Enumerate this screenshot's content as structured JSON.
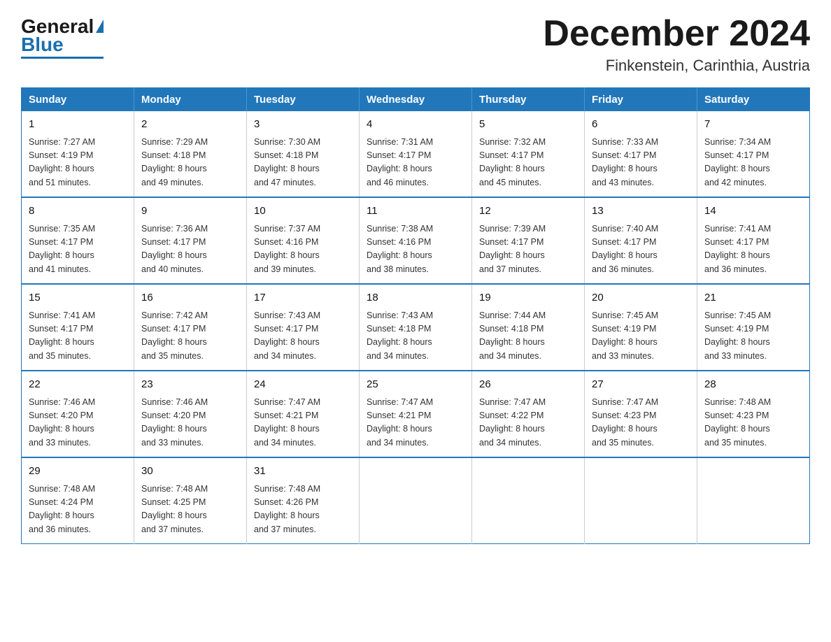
{
  "header": {
    "logo_general": "General",
    "logo_blue": "Blue",
    "title": "December 2024",
    "subtitle": "Finkenstein, Carinthia, Austria"
  },
  "calendar": {
    "headers": [
      "Sunday",
      "Monday",
      "Tuesday",
      "Wednesday",
      "Thursday",
      "Friday",
      "Saturday"
    ],
    "weeks": [
      [
        {
          "day": "1",
          "info": "Sunrise: 7:27 AM\nSunset: 4:19 PM\nDaylight: 8 hours\nand 51 minutes."
        },
        {
          "day": "2",
          "info": "Sunrise: 7:29 AM\nSunset: 4:18 PM\nDaylight: 8 hours\nand 49 minutes."
        },
        {
          "day": "3",
          "info": "Sunrise: 7:30 AM\nSunset: 4:18 PM\nDaylight: 8 hours\nand 47 minutes."
        },
        {
          "day": "4",
          "info": "Sunrise: 7:31 AM\nSunset: 4:17 PM\nDaylight: 8 hours\nand 46 minutes."
        },
        {
          "day": "5",
          "info": "Sunrise: 7:32 AM\nSunset: 4:17 PM\nDaylight: 8 hours\nand 45 minutes."
        },
        {
          "day": "6",
          "info": "Sunrise: 7:33 AM\nSunset: 4:17 PM\nDaylight: 8 hours\nand 43 minutes."
        },
        {
          "day": "7",
          "info": "Sunrise: 7:34 AM\nSunset: 4:17 PM\nDaylight: 8 hours\nand 42 minutes."
        }
      ],
      [
        {
          "day": "8",
          "info": "Sunrise: 7:35 AM\nSunset: 4:17 PM\nDaylight: 8 hours\nand 41 minutes."
        },
        {
          "day": "9",
          "info": "Sunrise: 7:36 AM\nSunset: 4:17 PM\nDaylight: 8 hours\nand 40 minutes."
        },
        {
          "day": "10",
          "info": "Sunrise: 7:37 AM\nSunset: 4:16 PM\nDaylight: 8 hours\nand 39 minutes."
        },
        {
          "day": "11",
          "info": "Sunrise: 7:38 AM\nSunset: 4:16 PM\nDaylight: 8 hours\nand 38 minutes."
        },
        {
          "day": "12",
          "info": "Sunrise: 7:39 AM\nSunset: 4:17 PM\nDaylight: 8 hours\nand 37 minutes."
        },
        {
          "day": "13",
          "info": "Sunrise: 7:40 AM\nSunset: 4:17 PM\nDaylight: 8 hours\nand 36 minutes."
        },
        {
          "day": "14",
          "info": "Sunrise: 7:41 AM\nSunset: 4:17 PM\nDaylight: 8 hours\nand 36 minutes."
        }
      ],
      [
        {
          "day": "15",
          "info": "Sunrise: 7:41 AM\nSunset: 4:17 PM\nDaylight: 8 hours\nand 35 minutes."
        },
        {
          "day": "16",
          "info": "Sunrise: 7:42 AM\nSunset: 4:17 PM\nDaylight: 8 hours\nand 35 minutes."
        },
        {
          "day": "17",
          "info": "Sunrise: 7:43 AM\nSunset: 4:17 PM\nDaylight: 8 hours\nand 34 minutes."
        },
        {
          "day": "18",
          "info": "Sunrise: 7:43 AM\nSunset: 4:18 PM\nDaylight: 8 hours\nand 34 minutes."
        },
        {
          "day": "19",
          "info": "Sunrise: 7:44 AM\nSunset: 4:18 PM\nDaylight: 8 hours\nand 34 minutes."
        },
        {
          "day": "20",
          "info": "Sunrise: 7:45 AM\nSunset: 4:19 PM\nDaylight: 8 hours\nand 33 minutes."
        },
        {
          "day": "21",
          "info": "Sunrise: 7:45 AM\nSunset: 4:19 PM\nDaylight: 8 hours\nand 33 minutes."
        }
      ],
      [
        {
          "day": "22",
          "info": "Sunrise: 7:46 AM\nSunset: 4:20 PM\nDaylight: 8 hours\nand 33 minutes."
        },
        {
          "day": "23",
          "info": "Sunrise: 7:46 AM\nSunset: 4:20 PM\nDaylight: 8 hours\nand 33 minutes."
        },
        {
          "day": "24",
          "info": "Sunrise: 7:47 AM\nSunset: 4:21 PM\nDaylight: 8 hours\nand 34 minutes."
        },
        {
          "day": "25",
          "info": "Sunrise: 7:47 AM\nSunset: 4:21 PM\nDaylight: 8 hours\nand 34 minutes."
        },
        {
          "day": "26",
          "info": "Sunrise: 7:47 AM\nSunset: 4:22 PM\nDaylight: 8 hours\nand 34 minutes."
        },
        {
          "day": "27",
          "info": "Sunrise: 7:47 AM\nSunset: 4:23 PM\nDaylight: 8 hours\nand 35 minutes."
        },
        {
          "day": "28",
          "info": "Sunrise: 7:48 AM\nSunset: 4:23 PM\nDaylight: 8 hours\nand 35 minutes."
        }
      ],
      [
        {
          "day": "29",
          "info": "Sunrise: 7:48 AM\nSunset: 4:24 PM\nDaylight: 8 hours\nand 36 minutes."
        },
        {
          "day": "30",
          "info": "Sunrise: 7:48 AM\nSunset: 4:25 PM\nDaylight: 8 hours\nand 37 minutes."
        },
        {
          "day": "31",
          "info": "Sunrise: 7:48 AM\nSunset: 4:26 PM\nDaylight: 8 hours\nand 37 minutes."
        },
        null,
        null,
        null,
        null
      ]
    ]
  }
}
